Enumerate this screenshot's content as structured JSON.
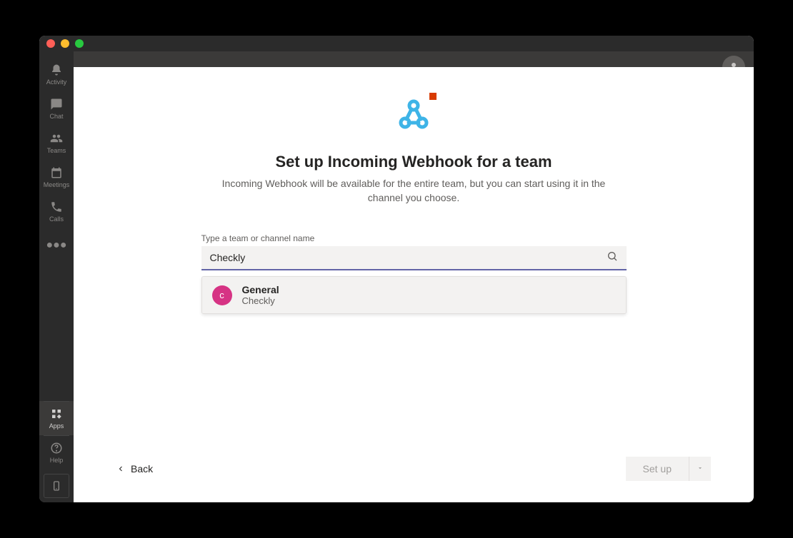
{
  "sidebar": {
    "items": [
      {
        "label": "Activity"
      },
      {
        "label": "Chat"
      },
      {
        "label": "Teams"
      },
      {
        "label": "Meetings"
      },
      {
        "label": "Calls"
      }
    ],
    "apps_label": "Apps",
    "help_label": "Help"
  },
  "modal": {
    "title": "Set up Incoming Webhook for a team",
    "subtitle": "Incoming Webhook will be available for the entire team, but you can start using it in the channel you choose.",
    "search_label": "Type a team or channel name",
    "search_value": "Checkly",
    "result": {
      "avatar_letter": "c",
      "channel_name": "General",
      "team_name": "Checkly"
    },
    "back_label": "Back",
    "setup_label": "Set up"
  },
  "colors": {
    "accent": "#6264a7",
    "pink": "#d63384"
  }
}
